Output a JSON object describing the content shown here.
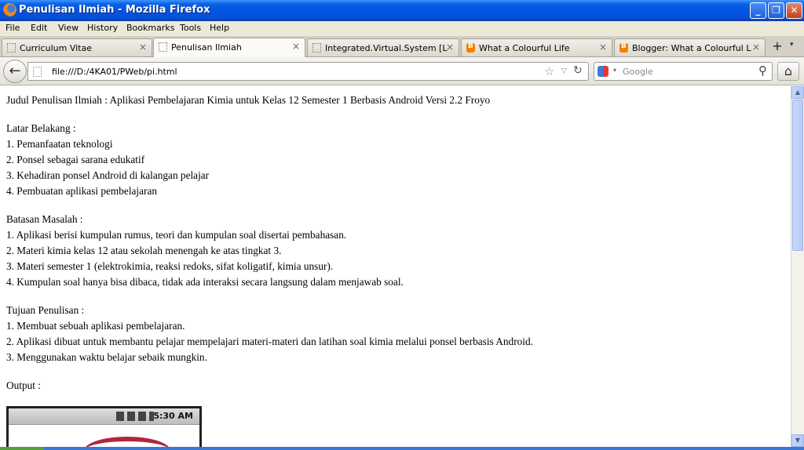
{
  "window": {
    "title": "Penulisan Ilmiah - Mozilla Firefox"
  },
  "window_controls": {
    "minimize": "_",
    "maximize": "❐",
    "close": "✕"
  },
  "menu": [
    "File",
    "Edit",
    "View",
    "History",
    "Bookmarks",
    "Tools",
    "Help"
  ],
  "tabs": [
    {
      "label": "Curriculum Vitae",
      "icon": "blank-page-icon",
      "active": false
    },
    {
      "label": "Penulisan Ilmiah",
      "icon": "blank-page-icon",
      "active": true
    },
    {
      "label": "Integrated.Virtual.System [Lo...",
      "icon": "blank-page-icon",
      "active": false
    },
    {
      "label": "What a Colourful Life",
      "icon": "blogger-icon",
      "active": false
    },
    {
      "label": "Blogger: What a Colourful Lif...",
      "icon": "blogger-icon",
      "active": false
    }
  ],
  "tab_close_glyph": "×",
  "new_tab_glyph": "+",
  "tab_list_glyph": "▾",
  "nav": {
    "back_glyph": "←",
    "url": "file:///D:/4KA01/PWeb/pi.html",
    "bookmark_star_glyph": "☆",
    "url_dropdown_glyph": "▽",
    "reload_glyph": "↻",
    "search_placeholder": "Google",
    "search_dropdown_glyph": "▾",
    "search_glyph": "⚲",
    "home_glyph": "⌂"
  },
  "content": {
    "title_line": "Judul Penulisan Ilmiah : Aplikasi Pembelajaran Kimia untuk Kelas 12 Semester 1 Berbasis Android Versi 2.2 Froyo",
    "sections": [
      {
        "heading": "Latar Belakang :",
        "items": [
          "1. Pemanfaatan teknologi",
          "2. Ponsel sebagai sarana edukatif",
          "3. Kehadiran ponsel Android di kalangan pelajar",
          "4. Pembuatan aplikasi pembelajaran"
        ]
      },
      {
        "heading": "Batasan Masalah :",
        "items": [
          "1. Aplikasi berisi kumpulan rumus, teori dan kumpulan soal disertai pembahasan.",
          "2. Materi kimia kelas 12 atau sekolah menengah ke atas tingkat 3.",
          "3. Materi semester 1 (elektrokimia, reaksi redoks, sifat koligatif, kimia unsur).",
          "4. Kumpulan soal hanya bisa dibaca, tidak ada interaksi secara langsung dalam menjawab soal."
        ]
      },
      {
        "heading": "Tujuan Penulisan :",
        "items": [
          "1. Membuat sebuah aplikasi pembelajaran.",
          "2. Aplikasi dibuat untuk membantu pelajar mempelajari materi-materi dan latihan soal kimia melalui ponsel berbasis Android.",
          "3. Menggunakan waktu belajar sebaik mungkin."
        ]
      }
    ],
    "output_label": "Output :",
    "phone_time": "5:30 AM"
  },
  "scrollbar": {
    "up_glyph": "▲",
    "down_glyph": "▼"
  }
}
